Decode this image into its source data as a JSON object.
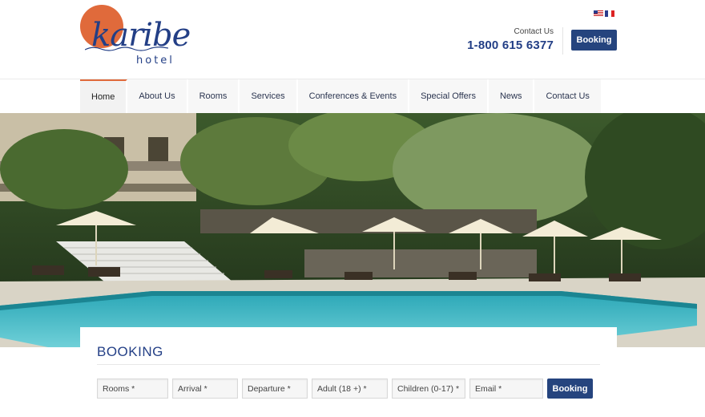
{
  "brand": {
    "name": "karibe",
    "subtitle": "hotel"
  },
  "header": {
    "languages": [
      "us-flag-icon",
      "fr-flag-icon"
    ],
    "contact_label": "Contact Us",
    "phone": "1-800 615 6377",
    "booking_button": "Booking"
  },
  "nav": {
    "items": [
      {
        "label": "Home",
        "active": true
      },
      {
        "label": "About Us"
      },
      {
        "label": "Rooms"
      },
      {
        "label": "Services"
      },
      {
        "label": "Conferences & Events"
      },
      {
        "label": "Special Offers"
      },
      {
        "label": "News"
      },
      {
        "label": "Contact Us"
      }
    ]
  },
  "booking": {
    "title": "BOOKING",
    "fields": [
      {
        "placeholder": "Rooms *"
      },
      {
        "placeholder": "Arrival *"
      },
      {
        "placeholder": "Departure *"
      },
      {
        "placeholder": "Adult (18 +) *"
      },
      {
        "placeholder": "Children (0-17) *"
      },
      {
        "placeholder": "Email *"
      }
    ],
    "submit_label": "Booking"
  },
  "colors": {
    "brand_blue": "#233f86",
    "accent_orange": "#e06a3b",
    "button_blue": "#25447e"
  }
}
